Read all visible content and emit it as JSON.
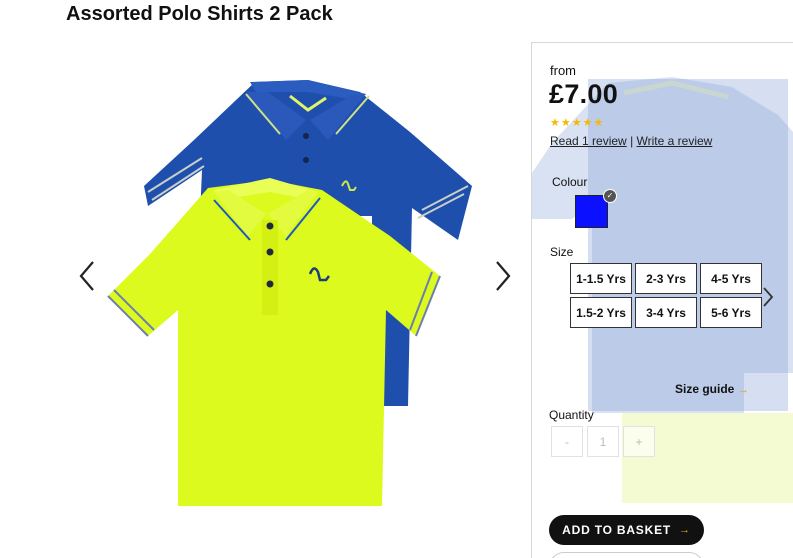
{
  "product": {
    "title": "Assorted Polo Shirts 2 Pack"
  },
  "gallery": {
    "prev_icon": "chevron-left-icon",
    "next_icon": "chevron-right-icon",
    "shirt_colors": {
      "back": "#1f4fad",
      "front": "#dcfa1e"
    }
  },
  "pricing": {
    "from_label": "from",
    "price": "£7.00",
    "rating": 5,
    "star_color": "#f6b900"
  },
  "reviews": {
    "read_label": "Read 1 review",
    "separator": "|",
    "write_label": "Write a review"
  },
  "colour": {
    "label": "Colour",
    "selected_swatch": "#0b10ff"
  },
  "size": {
    "label": "Size",
    "options": [
      "1-1.5 Yrs",
      "2-3 Yrs",
      "4-5 Yrs",
      "1.5-2 Yrs",
      "3-4 Yrs",
      "5-6 Yrs"
    ],
    "guide_label": "Size guide",
    "guide_arrow": "→"
  },
  "quantity": {
    "label": "Quantity",
    "minus": "-",
    "value": "1",
    "plus": "+"
  },
  "actions": {
    "add_to_basket": "ADD TO BASKET",
    "add_arrow": "→"
  }
}
